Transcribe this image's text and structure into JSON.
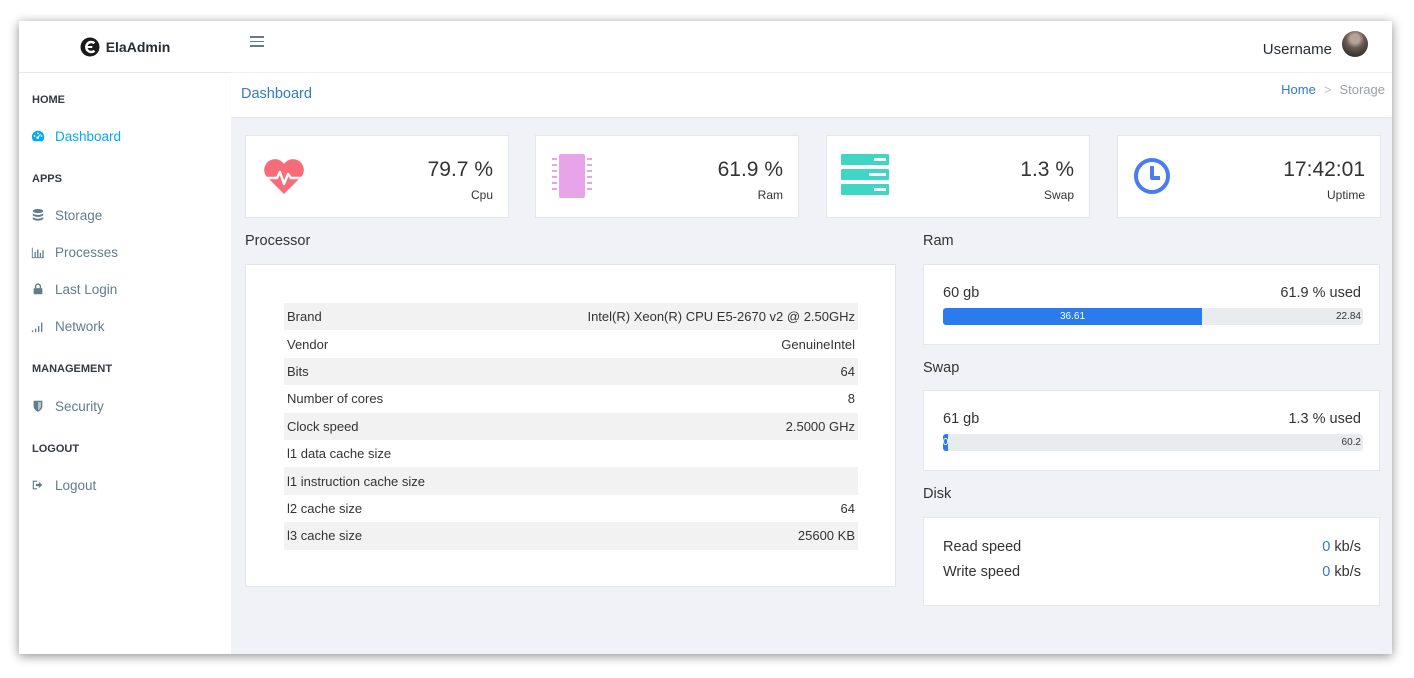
{
  "app": {
    "brand": "ElaAdmin"
  },
  "header": {
    "username": "Username"
  },
  "breadcrumb": {
    "page_title": "Dashboard",
    "home": "Home",
    "separator": ">",
    "current": "Storage"
  },
  "sidebar": {
    "sections": [
      {
        "title": "HOME",
        "items": [
          {
            "label": "Dashboard",
            "icon": "dashboard-icon",
            "active": true
          }
        ]
      },
      {
        "title": "APPS",
        "items": [
          {
            "label": "Storage",
            "icon": "database-icon"
          },
          {
            "label": "Processes",
            "icon": "bar-chart-icon"
          },
          {
            "label": "Last Login",
            "icon": "lock-icon"
          },
          {
            "label": "Network",
            "icon": "signal-icon"
          }
        ]
      },
      {
        "title": "MANAGEMENT",
        "items": [
          {
            "label": "Security",
            "icon": "shield-icon"
          }
        ]
      },
      {
        "title": "LOGOUT",
        "items": [
          {
            "label": "Logout",
            "icon": "sign-out-icon"
          }
        ]
      }
    ]
  },
  "stats": [
    {
      "value": "79.7 %",
      "label": "Cpu",
      "icon": "heartbeat-icon",
      "color": "#f86b78"
    },
    {
      "value": "61.9 %",
      "label": "Ram",
      "icon": "chip-icon",
      "color": "#e8a4e8"
    },
    {
      "value": "1.3 %",
      "label": "Swap",
      "icon": "server-icon",
      "color": "#3fd6c5"
    },
    {
      "value": "17:42:01",
      "label": "Uptime",
      "icon": "clock-icon",
      "color": "#4a7cf0"
    }
  ],
  "processor": {
    "title": "Processor",
    "rows": [
      {
        "label": "Brand",
        "value": "Intel(R) Xeon(R) CPU E5-2670 v2 @ 2.50GHz"
      },
      {
        "label": "Vendor",
        "value": "GenuineIntel"
      },
      {
        "label": "Bits",
        "value": "64"
      },
      {
        "label": "Number of cores",
        "value": "8"
      },
      {
        "label": "Clock speed",
        "value": "2.5000 GHz"
      },
      {
        "label": "l1 data cache size",
        "value": ""
      },
      {
        "label": "l1 instruction cache size",
        "value": ""
      },
      {
        "label": "l2 cache size",
        "value": "64"
      },
      {
        "label": "l3 cache size",
        "value": "25600 KB"
      }
    ]
  },
  "ram": {
    "title": "Ram",
    "total": "60 gb",
    "used_text": "61.9 % used",
    "used_value": "36.61",
    "free_value": "22.84",
    "used_fraction": 0.6159
  },
  "swap": {
    "title": "Swap",
    "total": "61 gb",
    "used_text": "1.3 % used",
    "used_value": "0",
    "free_value": "60.2",
    "used_fraction": 0.013
  },
  "disk": {
    "title": "Disk",
    "read_label": "Read speed",
    "read_value": "0",
    "read_unit": "kb/s",
    "write_label": "Write speed",
    "write_value": "0",
    "write_unit": "kb/s"
  },
  "colors": {
    "accent": "#2f7bc8",
    "progress": "#2a7bee"
  }
}
